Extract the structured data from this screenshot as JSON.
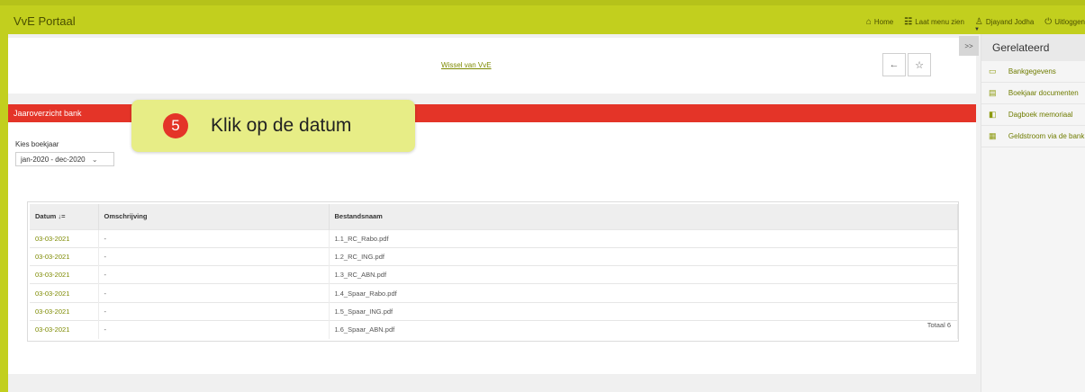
{
  "app": {
    "title": "VvE Portaal"
  },
  "topnav": {
    "home": "Home",
    "menu": "Laat menu zien",
    "user": "Djayand Jodha",
    "logout": "Uitloggen"
  },
  "header": {
    "wissel": "Wissel van VvE",
    "back_icon": "←",
    "star_icon": "☆"
  },
  "section": {
    "title": "Jaaroverzicht bank"
  },
  "filter": {
    "label": "Kies boekjaar",
    "value": "jan-2020 - dec-2020",
    "chevron": "v"
  },
  "table": {
    "headers": [
      "Datum ↓=",
      "Omschrijving",
      "Bestandsnaam"
    ],
    "rows": [
      [
        "03-03-2021",
        "-",
        "1.1_RC_Rabo.pdf"
      ],
      [
        "03-03-2021",
        "-",
        "1.2_RC_ING.pdf"
      ],
      [
        "03-03-2021",
        "-",
        "1.3_RC_ABN.pdf"
      ],
      [
        "03-03-2021",
        "-",
        "1.4_Spaar_Rabo.pdf"
      ],
      [
        "03-03-2021",
        "-",
        "1.5_Spaar_ING.pdf"
      ],
      [
        "03-03-2021",
        "-",
        "1.6_Spaar_ABN.pdf"
      ]
    ],
    "total": "Totaal 6"
  },
  "callout": {
    "number": "5",
    "text": "Klik op de datum"
  },
  "sidebar": {
    "toggle": ">>",
    "title": "Gerelateerd",
    "items": [
      {
        "label": "Bankgegevens",
        "icon": "card-icon"
      },
      {
        "label": "Boekjaar documenten",
        "icon": "document-icon"
      },
      {
        "label": "Dagboek memoriaal",
        "icon": "book-icon"
      },
      {
        "label": "Geldstroom via de bank",
        "icon": "money-icon"
      }
    ]
  },
  "colors": {
    "accent": "#c2cf1e",
    "red": "#e43428",
    "link": "#7d8a00",
    "callout": "#e7ed86"
  }
}
